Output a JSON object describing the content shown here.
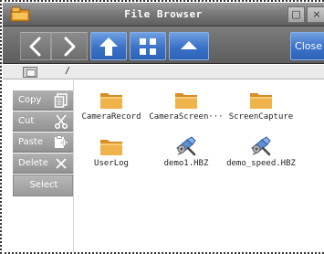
{
  "window": {
    "title": "File Browser",
    "maximize_glyph": "□",
    "close_glyph": "×"
  },
  "toolbar": {
    "back_icon": "chevron-left-icon",
    "forward_icon": "chevron-right-icon",
    "up_icon": "arrow-up-icon",
    "view_icon": "grid-view-icon",
    "eject_icon": "eject-icon",
    "close_label": "Close"
  },
  "pathbar": {
    "drive_icon": "drive-icon",
    "separator": "/"
  },
  "sidebar": {
    "copy_label": "Copy",
    "cut_label": "Cut",
    "paste_label": "Paste",
    "delete_label": "Delete",
    "select_label": "Select"
  },
  "files": [
    {
      "name": "CameraRecord",
      "kind": "folder"
    },
    {
      "name": "CameraScreen···",
      "kind": "folder"
    },
    {
      "name": "ScreenCapture",
      "kind": "folder"
    },
    {
      "name": "UserLog",
      "kind": "folder"
    },
    {
      "name": "demo1.HBZ",
      "kind": "hbz-file"
    },
    {
      "name": "demo_speed.HBZ",
      "kind": "hbz-file"
    }
  ],
  "colors": {
    "toolbar_blue": "#3b72c8",
    "folder": "#e9a33a",
    "sidebar_button": "#a2a2a2"
  }
}
